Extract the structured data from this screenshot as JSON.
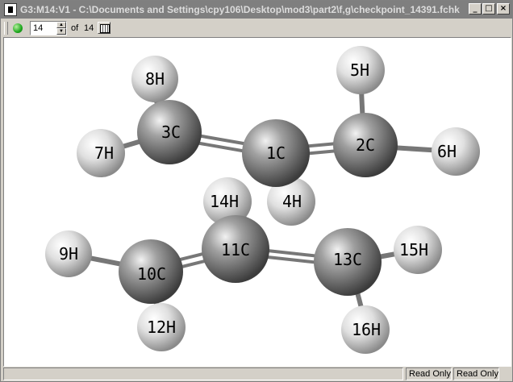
{
  "window": {
    "title": "G3:M14:V1 - C:\\Documents and Settings\\cpy106\\Desktop\\mod3\\part2\\f,g\\checkpoint_14391.fchk",
    "minimize_icon": "minimize-icon",
    "maximize_icon": "maximize-icon",
    "close_icon": "close-icon"
  },
  "toolbar": {
    "status_icon": "green-circle-icon",
    "frame_value": "14",
    "of_label": "of",
    "total_frames": "14",
    "frames_icon": "frames-table-icon"
  },
  "molecule": {
    "atoms": [
      {
        "label": "1C"
      },
      {
        "label": "2C"
      },
      {
        "label": "3C"
      },
      {
        "label": "4H"
      },
      {
        "label": "5H"
      },
      {
        "label": "6H"
      },
      {
        "label": "7H"
      },
      {
        "label": "8H"
      },
      {
        "label": "9H"
      },
      {
        "label": "10C"
      },
      {
        "label": "11C"
      },
      {
        "label": "12H"
      },
      {
        "label": "13C"
      },
      {
        "label": "14H"
      },
      {
        "label": "15H"
      },
      {
        "label": "16H"
      }
    ]
  },
  "statusbar": {
    "read_only_1": "Read Only",
    "read_only_2": "Read Only"
  },
  "colors": {
    "carbon": "#8a8a8a",
    "hydrogen": "#e8e8e8",
    "titlebar": "#7f7f7f",
    "background": "#d4d0c8"
  }
}
